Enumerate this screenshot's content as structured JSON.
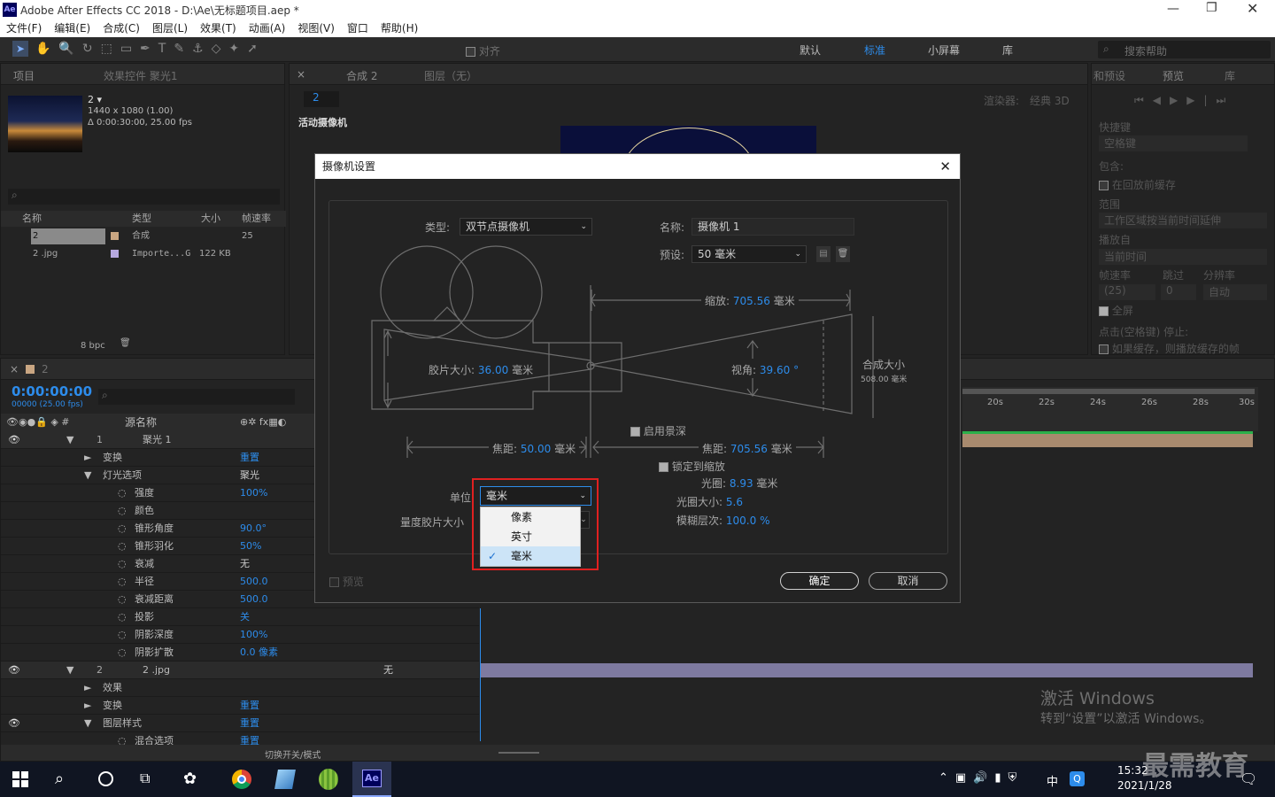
{
  "window": {
    "title": "Adobe After Effects CC 2018 - D:\\Ae\\无标题项目.aep *"
  },
  "menu": [
    "文件(F)",
    "编辑(E)",
    "合成(C)",
    "图层(L)",
    "效果(T)",
    "动画(A)",
    "视图(V)",
    "窗口",
    "帮助(H)"
  ],
  "toolbar": {
    "snap_label": "对齐",
    "workspaces": [
      "默认",
      "标准",
      "小屏幕",
      "库"
    ],
    "search_placeholder": "搜索帮助"
  },
  "project_panel": {
    "tab_project": "项目",
    "tab_effects": "效果控件 聚光1",
    "comp_name": "2 ▾",
    "comp_info1": "1440 x 1080 (1.00)",
    "comp_info2": "Δ 0:00:30:00, 25.00 fps",
    "col_name": "名称",
    "col_type": "类型",
    "col_size": "大小",
    "col_fps": "帧速率",
    "items": [
      {
        "name": "2",
        "type": "合成",
        "size": "",
        "fps": "25"
      },
      {
        "name": "2 .jpg",
        "type": "Importe...G",
        "size": "122 KB",
        "fps": ""
      }
    ],
    "bpc": "8 bpc"
  },
  "comp_panel": {
    "tab_comp": "合成 2",
    "tab_layer": "图层（无）",
    "breadcrumb": "2",
    "renderer_label": "渲染器:",
    "renderer_value": "经典 3D",
    "camera_label": "活动摄像机"
  },
  "right_panel": {
    "tab_preview": "预览",
    "tab_presets": "和预设",
    "tab_lib": "库",
    "shortcut": "快捷键",
    "shortcut_value": "空格键",
    "include": "包含:",
    "cache_before": "在回放前缓存",
    "range": "范围",
    "range_value": "工作区域按当前时间延伸",
    "play_from": "播放自",
    "play_from_value": "当前时间",
    "fps": "帧速率",
    "skip": "跳过",
    "resolution": "分辨率",
    "fps_value": "(25)",
    "skip_value": "0",
    "res_value": "自动",
    "fullscreen": "全屏",
    "stop_on": "点击(空格键) 停止:",
    "if_cached": "如果缓存，则播放缓存的帧"
  },
  "timeline": {
    "tab": "2",
    "timecode": "0:00:00:00",
    "frames": "00000 (25.00 fps)",
    "col_source": "源名称",
    "ruler": [
      "20s",
      "22s",
      "24s",
      "26s",
      "28s",
      "30s"
    ],
    "toggle_label": "切换开关/模式",
    "layers": [
      {
        "num": "1",
        "name": "聚光 1",
        "indent": 0,
        "value": ""
      },
      {
        "name": "变换",
        "indent": 1,
        "value": "重置"
      },
      {
        "name": "灯光选项",
        "indent": 1,
        "value": "聚光"
      },
      {
        "name": "强度",
        "indent": 2,
        "value": "100%"
      },
      {
        "name": "颜色",
        "indent": 2,
        "value": ""
      },
      {
        "name": "锥形角度",
        "indent": 2,
        "value": "90.0°"
      },
      {
        "name": "锥形羽化",
        "indent": 2,
        "value": "50%"
      },
      {
        "name": "衰减",
        "indent": 2,
        "value": "无"
      },
      {
        "name": "半径",
        "indent": 2,
        "value": "500.0"
      },
      {
        "name": "衰减距离",
        "indent": 2,
        "value": "500.0"
      },
      {
        "name": "投影",
        "indent": 2,
        "value": "关"
      },
      {
        "name": "阴影深度",
        "indent": 2,
        "value": "100%"
      },
      {
        "name": "阴影扩散",
        "indent": 2,
        "value": "0.0 像素"
      },
      {
        "num": "2",
        "name": "2 .jpg",
        "indent": 0,
        "value": "无"
      },
      {
        "name": "效果",
        "indent": 1,
        "value": ""
      },
      {
        "name": "变换",
        "indent": 1,
        "value": "重置"
      },
      {
        "name": "图层样式",
        "indent": 1,
        "value": "重置"
      },
      {
        "name": "混合选项",
        "indent": 2,
        "value": "重置"
      }
    ]
  },
  "dialog": {
    "title": "摄像机设置",
    "type_label": "类型:",
    "type_value": "双节点摄像机",
    "name_label": "名称:",
    "name_value": "摄像机 1",
    "preset_label": "预设:",
    "preset_value": "50 毫米",
    "zoom_label": "缩放:",
    "zoom_value": "705.56",
    "zoom_unit": "毫米",
    "film_label": "胶片大小:",
    "film_value": "36.00",
    "film_unit": "毫米",
    "aov_label": "视角:",
    "aov_value": "39.60",
    "aov_unit": "°",
    "comp_size_label": "合成大小",
    "comp_size_value": "508.00 毫米",
    "dof_label": "启用景深",
    "focal_label": "焦距:",
    "focal_value": "50.00",
    "focal_unit": "毫米",
    "focus_label": "焦距:",
    "focus_value": "705.56",
    "focus_unit": "毫米",
    "lock_label": "锁定到缩放",
    "aperture_label": "光圈:",
    "aperture_value": "8.93",
    "aperture_unit": "毫米",
    "fstop_label": "光圈大小:",
    "fstop_value": "5.6",
    "blur_label": "模糊层次:",
    "blur_value": "100.0",
    "blur_unit": "%",
    "units_label": "单位",
    "units_value": "毫米",
    "units_options": [
      "像素",
      "英寸",
      "毫米"
    ],
    "measure_label": "量度胶片大小",
    "preview_label": "预览",
    "ok": "确定",
    "cancel": "取消"
  },
  "watermark": {
    "line1": "激活 Windows",
    "line2": "转到“设置”以激活 Windows。",
    "brand": "最需教育"
  },
  "taskbar": {
    "time": "15:32",
    "date": "2021/1/28",
    "ime": "中",
    "app": "Ae"
  }
}
